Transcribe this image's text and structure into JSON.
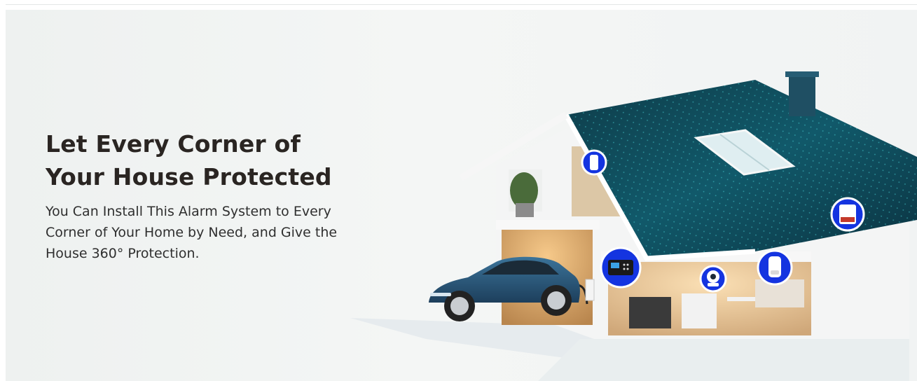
{
  "hero": {
    "headline_line1": "Let Every Corner of",
    "headline_line2": "Your House Protected",
    "subtext_line1": "You Can Install This Alarm System to Every",
    "subtext_line2": "Corner of Your Home by Need, and Give the",
    "subtext_line3": "House 360° Protection."
  },
  "illustration": {
    "devices": [
      {
        "icon": "door-sensor-icon"
      },
      {
        "icon": "siren-icon"
      },
      {
        "icon": "alarm-panel-icon"
      },
      {
        "icon": "ip-camera-icon"
      },
      {
        "icon": "pir-sensor-icon"
      }
    ],
    "colors": {
      "roof": "#0f4f5e",
      "roof_glow": "#38d3d8",
      "device_badge": "#1434e0",
      "car": "#2e5f86",
      "wall": "#f7f8f8"
    }
  }
}
